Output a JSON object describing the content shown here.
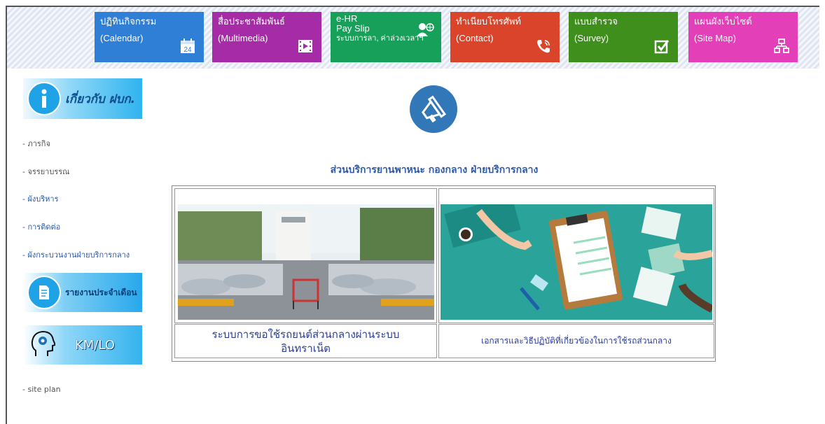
{
  "tiles": [
    {
      "line1": "ปฏิทินกิจกรรม",
      "line2": "(Calendar)",
      "color": "#2f7fd6",
      "icon": "calendar-icon",
      "badge": "24"
    },
    {
      "line1": "สื่อประชาสัมพันธ์",
      "line2": "(Multimedia)",
      "color": "#a62ba6",
      "icon": "film-icon"
    },
    {
      "line1": "e-HR",
      "line2": "Pay Slip",
      "line3": "ระบบการลา, ค่าล่วงเวลาฯ",
      "color": "#16a05a",
      "icon": "user-globe-icon"
    },
    {
      "line1": "ทำเนียบโทรศัพท์",
      "line2": "(Contact)",
      "color": "#d9442a",
      "icon": "phone-icon"
    },
    {
      "line1": "แบบสำรวจ",
      "line2": "(Survey)",
      "color": "#3f8f1d",
      "icon": "checkbox-icon"
    },
    {
      "line1": "แผนผังเว็บไซต์",
      "line2": "(Site Map)",
      "color": "#e33fb8",
      "icon": "sitemap-icon"
    }
  ],
  "sidebar": {
    "about_banner": "เกี่ยวกับ ฝบก.",
    "links1": [
      {
        "label": "- ภารกิจ"
      },
      {
        "label": "- จรรยาบรรณ"
      },
      {
        "label": "- ผังบริหาร"
      },
      {
        "label": "- การติดต่อ"
      },
      {
        "label": "- ผังกระบวนงานฝ่ายบริการกลาง"
      }
    ],
    "report_banner": "รายงานประจำเดือน",
    "km_banner": "KM/LO",
    "links2": [
      {
        "label": "- site plan"
      }
    ]
  },
  "main": {
    "icon": "megaphone-icon",
    "title": "ส่วนบริการยานพาหนะ กองกลาง ฝ่ายบริการกลาง",
    "cards": [
      {
        "caption": "ระบบการขอใช้รถยนต์ส่วนกลางผ่านระบบอินทราเน็ต",
        "image": "parking-lot-photo"
      },
      {
        "caption": "เอกสารและวิธีปฏิบัติที่เกี่ยวข้องในการใช้รถส่วนกลาง",
        "image": "documents-illustration"
      }
    ]
  }
}
